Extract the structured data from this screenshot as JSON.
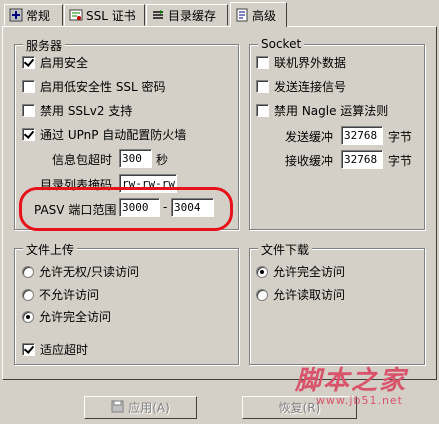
{
  "tabs": [
    {
      "label": "常规",
      "icon": "settings-icon"
    },
    {
      "label": "SSL 证书",
      "icon": "certificate-icon"
    },
    {
      "label": "目录缓存",
      "icon": "cache-icon"
    },
    {
      "label": "高级",
      "icon": "advanced-icon"
    }
  ],
  "server": {
    "title": "服务器",
    "enable_security": "启用安全",
    "enable_low_ssl": "启用低安全性 SSL 密码",
    "disable_sslv2": "禁用 SSLv2 支持",
    "upnp": "通过 UPnP 自动配置防火墙",
    "packet_timeout_label": "信息包超时",
    "packet_timeout_value": "300",
    "packet_timeout_unit": "秒",
    "dir_mask_label": "目录列表掩码",
    "dir_mask_value": "rw-rw-rw-",
    "pasv_label": "PASV 端口范围",
    "pasv_from": "3000",
    "pasv_dash": "-",
    "pasv_to": "3004"
  },
  "socket": {
    "title": "Socket",
    "oob_data": "联机界外数据",
    "send_keepalive": "发送连接信号",
    "disable_nagle": "禁用 Nagle 运算法则",
    "send_buffer_label": "发送缓冲",
    "send_buffer_value": "32768",
    "send_buffer_unit": "字节",
    "recv_buffer_label": "接收缓冲",
    "recv_buffer_value": "32768",
    "recv_buffer_unit": "字节"
  },
  "upload": {
    "title": "文件上传",
    "opt_no_perm": "允许无权/只读访问",
    "opt_deny": "不允许访问",
    "opt_full": "允许完全访问",
    "adapt_timeout": "适应超时"
  },
  "download": {
    "title": "文件下载",
    "opt_full": "允许完全访问",
    "opt_read": "允许读取访问"
  },
  "buttons": {
    "apply": "应用(A)",
    "restore": "恢复(R)"
  },
  "watermark": {
    "text": "脚本之家",
    "url": "www.jb51.net"
  },
  "colors": {
    "highlight": "#e8121b",
    "watermark": "#d9546b"
  }
}
